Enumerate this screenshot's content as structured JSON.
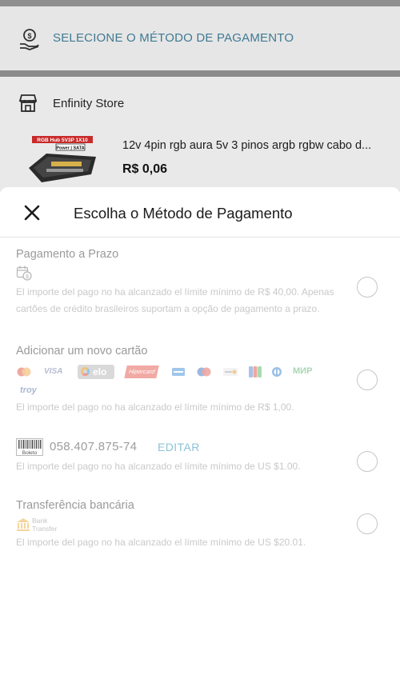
{
  "background": {
    "payment_header": "SELECIONE O MÉTODO DE PAGAMENTO",
    "store": {
      "name": "Enfinity Store",
      "thumb_label_1": "RGB Hub 5V3P 1X10",
      "thumb_label_2": "Power | SATA",
      "product_title": "12v 4pin rgb aura 5v 3 pinos argb rgbw cabo d...",
      "price": "R$ 0,06"
    }
  },
  "sheet": {
    "title": "Escolha o Método de Pagamento",
    "options": [
      {
        "title": "Pagamento a Prazo",
        "note": "El importe del pago no ha alcanzado el límite mínimo de R$ 40,00. Apenas cartões de crédito brasileiros suportam a opção de pagamento a prazo."
      },
      {
        "title": "Adicionar um novo cartão",
        "cards": [
          "VISA",
          "elo",
          "Hipercard",
          "МИР",
          "troy"
        ],
        "note": "El importe del pago no ha alcanzado el límite mínimo de R$ 1,00."
      },
      {
        "boleto_label": "Boleto",
        "document": "058.407.875-74",
        "edit": "EDITAR",
        "note": "El importe del pago no ha alcanzado el límite mínimo de US $1.00."
      },
      {
        "title": "Transferência bancária",
        "bank_label_1": "Bank",
        "bank_label_2": "Transfer",
        "note": "El importe del pago no ha alcanzado el límite mínimo de US $20.01."
      }
    ]
  },
  "colors": {
    "accent_link": "#8cc3d8",
    "header_link": "#3f7a92",
    "muted_text": "#c9c9c9"
  }
}
